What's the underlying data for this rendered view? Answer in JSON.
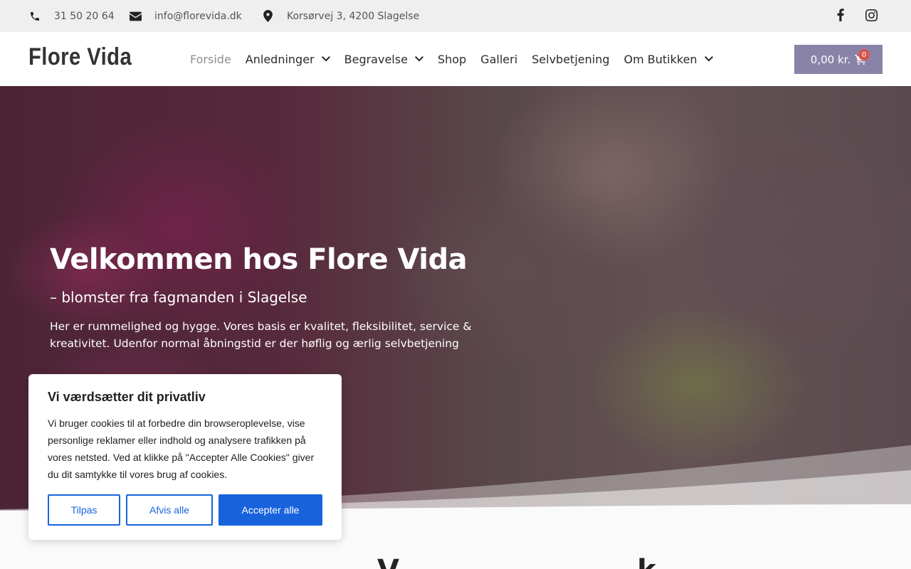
{
  "topbar": {
    "phone": "31 50 20 64",
    "email": "info@florevida.dk",
    "address": "Korsørvej 3, 4200 Slagelse",
    "icons": [
      "phone-icon",
      "envelope-icon",
      "map-pin-icon",
      "facebook-icon",
      "instagram-icon"
    ]
  },
  "header": {
    "logo": "Flore Vida",
    "nav": [
      {
        "label": "Forside",
        "active": true
      },
      {
        "label": "Anledninger",
        "dropdown": true
      },
      {
        "label": "Begravelse",
        "dropdown": true
      },
      {
        "label": "Shop"
      },
      {
        "label": "Galleri"
      },
      {
        "label": "Selvbetjening"
      },
      {
        "label": "Om Butikken",
        "dropdown": true
      }
    ],
    "cart": {
      "total": "0,00 kr.",
      "count": "0"
    }
  },
  "hero": {
    "title": "Velkommen hos Flore Vida",
    "subtitle": "– blomster fra fagmanden i Slagelse",
    "text": "Her er rummelighed og hygge. Vores basis er kvalitet, fleksibilitet, service & kreativitet. Udenfor normal åbningstid er der høflig og ærlig selvbetjening"
  },
  "cookie": {
    "title": "Vi værdsætter dit privatliv",
    "text": "Vi bruger cookies til at forbedre din browseroplevelse, vise personlige reklamer eller indhold og analysere trafikken på vores netsted. Ved at klikke på \"Accepter Alle Cookies\" giver du dit samtykke til vores brug af cookies.",
    "customize": "Tilpas",
    "reject": "Afvis alle",
    "accept": "Accepter alle"
  },
  "colors": {
    "accent": "#8a83a8",
    "cookie_button": "#1863dc",
    "badge": "#d9534f"
  }
}
